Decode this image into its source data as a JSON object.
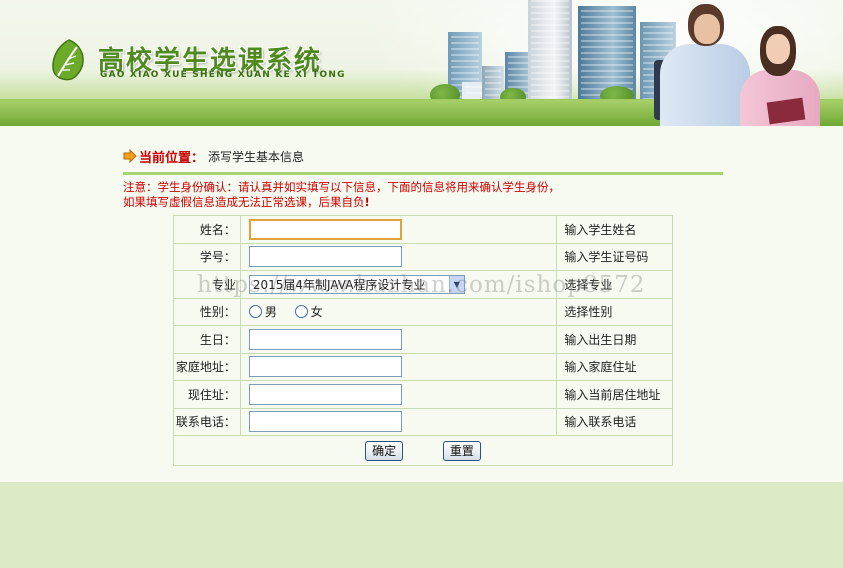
{
  "header": {
    "title": "高校学生选课系统",
    "subtitle": "GAO XIAO XUE SHENG XUAN KE XI TONG",
    "logo_icon": "leaf-icon"
  },
  "breadcrumb": {
    "label": "当前位置：",
    "value": "添写学生基本信息",
    "icon": "arrow-right-icon"
  },
  "notice": {
    "line1": "注意：学生身份确认：请认真并如实填写以下信息，下面的信息将用来确认学生身份，",
    "line2": "如果填写虚假信息造成无法正常选课，后果自负",
    "mark": "!"
  },
  "form": {
    "rows": [
      {
        "label": "姓名：",
        "hint": "输入学生姓名",
        "value": ""
      },
      {
        "label": "学号：",
        "hint": "输入学生证号码",
        "value": ""
      },
      {
        "label": "专业",
        "hint": "选择专业",
        "selected": "2015届4年制JAVA程序设计专业"
      },
      {
        "label": "性别：",
        "hint": "选择性别",
        "options": [
          "男",
          "女"
        ]
      },
      {
        "label": "生日：",
        "hint": "输入出生日期",
        "value": ""
      },
      {
        "label": "家庭地址：",
        "hint": "输入家庭住址",
        "value": ""
      },
      {
        "label": "现住址：",
        "hint": "输入当前居住地址",
        "value": ""
      },
      {
        "label": "联系电话：",
        "hint": "输入联系电话",
        "value": ""
      }
    ],
    "submit_label": "确定",
    "reset_label": "重置"
  },
  "watermark": "https://www.huzhan.com/ishop8572",
  "colors": {
    "accent_green": "#4e8a1d",
    "divider_green": "#a8d56e",
    "warning_red": "#cc0000",
    "page_bg": "#dcebc6"
  }
}
